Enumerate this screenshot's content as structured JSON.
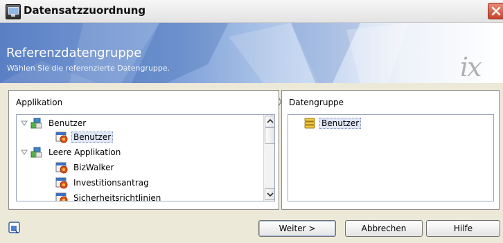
{
  "window": {
    "title": "Datensatzzuordnung"
  },
  "banner": {
    "title": "Referenzdatengruppe",
    "subtitle": "Wählen Sie die referenzierte Datengruppe.",
    "logo": "ix"
  },
  "left_panel": {
    "label": "Applikation",
    "tree": [
      {
        "label": "Benutzer",
        "level": 0,
        "expanded": true,
        "icon": "application-icon"
      },
      {
        "label": "Benutzer",
        "level": 1,
        "selected": true,
        "icon": "datagroup-icon"
      },
      {
        "label": "Leere Applikation",
        "level": 0,
        "expanded": true,
        "icon": "application-icon"
      },
      {
        "label": "BizWalker",
        "level": 1,
        "icon": "datagroup-icon"
      },
      {
        "label": "Investitionsantrag",
        "level": 1,
        "icon": "datagroup-icon"
      },
      {
        "label": "Sicherheitsrichtlinien",
        "level": 1,
        "icon": "datagroup-icon"
      }
    ]
  },
  "right_panel": {
    "label": "Datengruppe",
    "items": [
      {
        "label": "Benutzer",
        "selected": true,
        "icon": "database-icon"
      }
    ]
  },
  "buttons": {
    "next": "Weiter >",
    "cancel": "Abbrechen",
    "help": "Hilfe"
  },
  "colors": {
    "banner_blue": "#5a7fc4",
    "close_red": "#c8442a",
    "window_bg": "#ece9d8"
  }
}
